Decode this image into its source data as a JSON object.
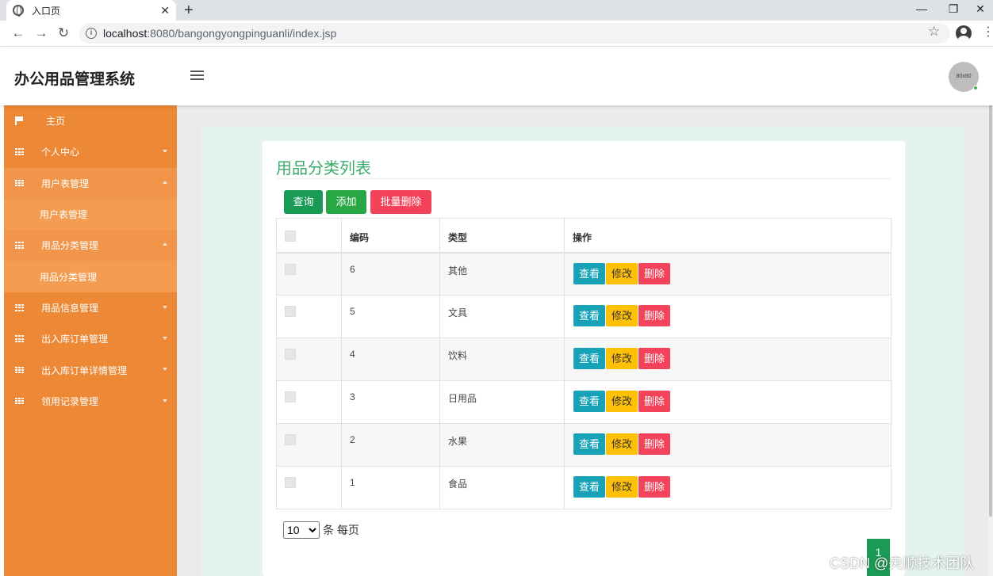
{
  "browser": {
    "tab_title": "入口页",
    "tab_close": "✕",
    "new_tab": "+",
    "url_host": "localhost",
    "url_rest": ":8080/bangongyongpinguanli/index.jsp",
    "window_controls": {
      "minimize": "—",
      "restore": "❐",
      "close": "✕"
    },
    "nav": {
      "back": "←",
      "forward": "→",
      "reload": "↻"
    },
    "star": "☆",
    "menu_dots": "⋮"
  },
  "header": {
    "title": "办公用品管理系统",
    "avatar_text": "80x80"
  },
  "sidebar": {
    "items": [
      {
        "label": "主页",
        "icon": "flag-icon"
      },
      {
        "label": "个人中心",
        "icon": "grid-icon"
      },
      {
        "label": "用户表管理",
        "icon": "grid-icon",
        "sub": "用户表管理"
      },
      {
        "label": "用品分类管理",
        "icon": "grid-icon",
        "sub": "用品分类管理"
      },
      {
        "label": "用品信息管理",
        "icon": "grid-icon"
      },
      {
        "label": "出入库订单管理",
        "icon": "grid-icon"
      },
      {
        "label": "出入库订单详情管理",
        "icon": "grid-icon"
      },
      {
        "label": "领用记录管理",
        "icon": "grid-icon"
      }
    ]
  },
  "main": {
    "title": "用品分类列表",
    "buttons": {
      "query": "查询",
      "add": "添加",
      "batch_delete": "批量删除"
    },
    "table": {
      "headers": {
        "code": "编码",
        "type": "类型",
        "ops": "操作"
      },
      "rows": [
        {
          "code": "6",
          "type": "其他"
        },
        {
          "code": "5",
          "type": "文具"
        },
        {
          "code": "4",
          "type": "饮料"
        },
        {
          "code": "3",
          "type": "日用品"
        },
        {
          "code": "2",
          "type": "水果"
        },
        {
          "code": "1",
          "type": "食品"
        }
      ],
      "ops": {
        "view": "查看",
        "edit": "修改",
        "delete": "删除"
      }
    },
    "pager": {
      "page_size": "10",
      "suffix": "条 每页",
      "current_page": "1"
    }
  },
  "watermark": "CSDN @央顺技术团队",
  "colors": {
    "sidebar": "#ed8936",
    "title_green": "#3daa6b",
    "btn_green": "#199a55",
    "btn_red": "#f2435a",
    "btn_teal": "#17a2b8",
    "btn_yellow": "#ffc107",
    "content_bg": "#e4f4ec"
  }
}
